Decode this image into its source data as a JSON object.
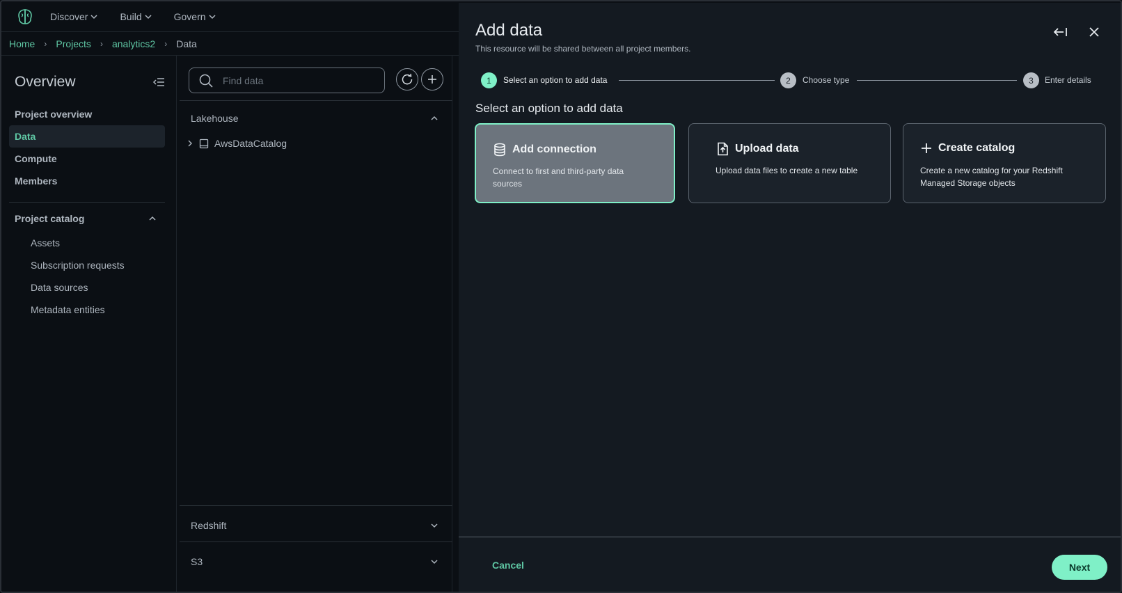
{
  "nav": {
    "items": [
      {
        "label": "Discover"
      },
      {
        "label": "Build"
      },
      {
        "label": "Govern"
      }
    ]
  },
  "breadcrumb": {
    "items": [
      "Home",
      "Projects",
      "analytics2"
    ],
    "current": "Data"
  },
  "sidebar": {
    "title": "Overview",
    "items": [
      {
        "label": "Project overview"
      },
      {
        "label": "Data"
      },
      {
        "label": "Compute"
      },
      {
        "label": "Members"
      }
    ],
    "catalog": {
      "label": "Project catalog",
      "items": [
        "Assets",
        "Subscription requests",
        "Data sources",
        "Metadata entities"
      ]
    }
  },
  "data_panel": {
    "search_placeholder": "Find data",
    "sections": [
      {
        "label": "Lakehouse",
        "expanded": true,
        "items": [
          "AwsDataCatalog"
        ]
      },
      {
        "label": "Redshift",
        "expanded": false
      },
      {
        "label": "S3",
        "expanded": false
      }
    ]
  },
  "drawer": {
    "title": "Add data",
    "subtitle": "This resource will be shared between all project members.",
    "steps": [
      {
        "number": "1",
        "label": "Select an option to add data",
        "state": "current"
      },
      {
        "number": "2",
        "label": "Choose type",
        "state": "todo"
      },
      {
        "number": "3",
        "label": "Enter details",
        "state": "todo"
      }
    ],
    "section_heading": "Select an option to add data",
    "options": [
      {
        "title": "Add connection",
        "description": "Connect to first and third-party data sources",
        "icon": "database-icon",
        "selected": true
      },
      {
        "title": "Upload data",
        "description": "Upload data files to create a new table",
        "icon": "file-upload-icon",
        "selected": false
      },
      {
        "title": "Create catalog",
        "description": "Create a new catalog for your Redshift Managed Storage objects",
        "icon": "plus-icon",
        "selected": false
      }
    ],
    "cancel_label": "Cancel",
    "next_label": "Next"
  },
  "colors": {
    "accent": "#7ff0c7",
    "link": "#5fc7a4",
    "background": "#0b0f14",
    "drawer": "#141a21"
  }
}
